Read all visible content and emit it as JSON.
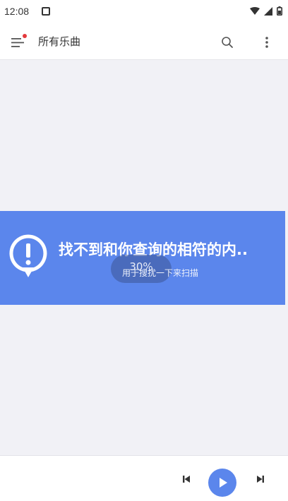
{
  "status_bar": {
    "time": "12:08"
  },
  "app_bar": {
    "title": "所有乐曲"
  },
  "banner": {
    "message": "找不到和你查询的相符的内..",
    "progress": "30%",
    "hint": "用于搜扰一下来扫描"
  },
  "colors": {
    "accent": "#5b86ec",
    "background": "#f1f1f6",
    "badge": "#e4393c"
  },
  "icons": [
    "menu-icon",
    "search-icon",
    "more-vert-icon",
    "alert-icon",
    "previous-icon",
    "play-icon",
    "next-icon"
  ]
}
